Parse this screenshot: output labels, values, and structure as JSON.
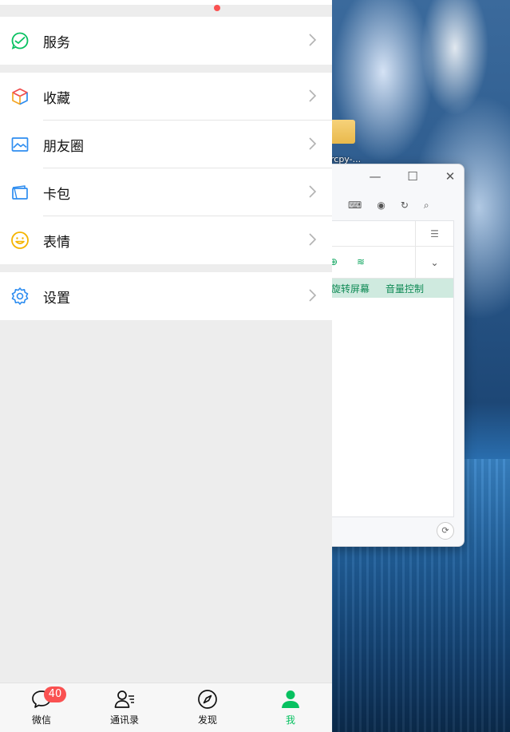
{
  "desktop": {
    "folder_label": "rcpy-..."
  },
  "background_window": {
    "controls": [
      "—",
      "☐",
      "✕"
    ],
    "actions": {
      "rotate_label": "旋转屏幕",
      "volume_label": "音量控制"
    }
  },
  "menu": {
    "services": {
      "label": "服务",
      "icon": "wechat-pay-icon"
    },
    "favorites": {
      "label": "收藏",
      "icon": "cube-icon"
    },
    "moments": {
      "label": "朋友圈",
      "icon": "picture-icon"
    },
    "cards": {
      "label": "卡包",
      "icon": "wallet-icon"
    },
    "stickers": {
      "label": "表情",
      "icon": "smile-icon"
    },
    "settings": {
      "label": "设置",
      "icon": "gear-icon"
    }
  },
  "tabbar": {
    "chats": {
      "label": "微信",
      "badge": "40"
    },
    "contacts": {
      "label": "通讯录"
    },
    "discover": {
      "label": "发现"
    },
    "me": {
      "label": "我"
    }
  },
  "colors": {
    "accent": "#07c160",
    "badge": "#fa5151",
    "background": "#ededed"
  }
}
